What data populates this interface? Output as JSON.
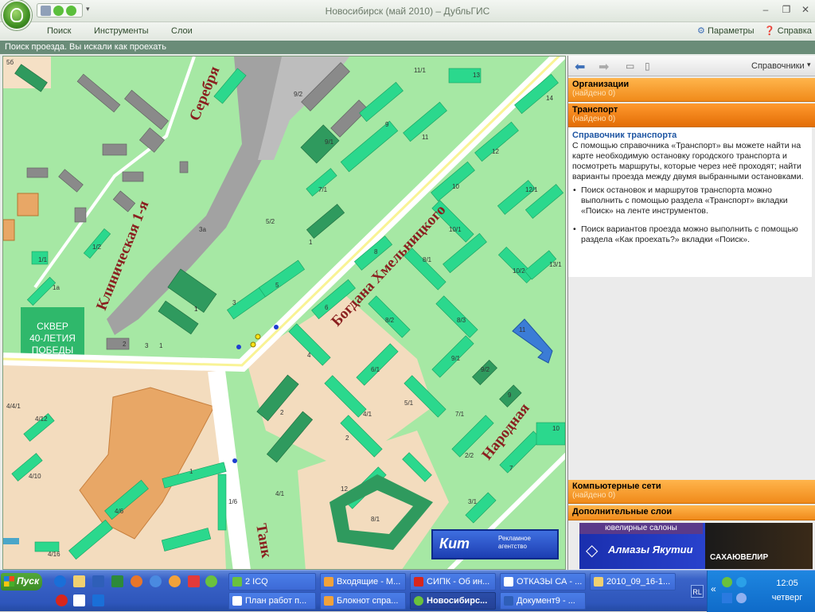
{
  "window": {
    "title": "Новосибирск (май 2010) – ДубльГИС",
    "controls": [
      "‒",
      "❐",
      "✕"
    ]
  },
  "menu": {
    "items": [
      "Поиск",
      "Инструменты",
      "Слои"
    ],
    "right": [
      "Параметры",
      "Справка"
    ]
  },
  "status_strip": "Поиск проезда. Вы искали как проехать",
  "map": {
    "streets": {
      "khmelnitsky": "Богдана Хмельницкого",
      "klinicheskaya": "Клиническая 1-я",
      "serebr": "Серебря",
      "narodnaya": "Народная",
      "tank": "Танк"
    },
    "square_label": [
      "СКВЕР",
      "40-ЛЕТИЯ",
      "ПОБЕДЫ"
    ],
    "house_numbers": [
      "9/2",
      "11/1",
      "13",
      "14",
      "9",
      "9/1",
      "11",
      "12",
      "7/1",
      "10",
      "12/1",
      "5/2",
      "3а",
      "1",
      "10/1",
      "1",
      "8",
      "8/1",
      "10/2",
      "13/1",
      "5",
      "3",
      "1",
      "6",
      "8/2",
      "8/3",
      "11",
      "6/1",
      "9/1",
      "9/2",
      "4",
      "2",
      "5/1",
      "4/1",
      "7/1",
      "9",
      "1",
      "2",
      "2/2",
      "7",
      "10",
      "12",
      "3/1",
      "8/1",
      "3",
      "1",
      "1/1",
      "1/2",
      "1а",
      "2",
      "4/12",
      "4/10",
      "4/16",
      "1/6",
      "4/6",
      "4/4/1",
      "5б",
      "4/1"
    ],
    "ad_text": "Рекламное агентство",
    "ad_brand": "Кит"
  },
  "panel": {
    "catalogs_label": "Справочники",
    "sections": [
      {
        "title": "Организации",
        "sub": "(найдено 0)"
      },
      {
        "title": "Транспорт",
        "sub": "(найдено 0)"
      }
    ],
    "info": {
      "heading": "Справочник транспорта",
      "text": "С помощью справочника «Транспорт» вы можете найти на карте необходимую остановку городского транспорта и посмотреть маршруты, которые через неё проходят; найти варианты проезда между двумя выбранными остановками.",
      "bullets": [
        "Поиск остановок и маршрутов транспорта можно выполнить с помощью раздела «Транспорт» вкладки «Поиск» на ленте инструментов.",
        "Поиск вариантов проезда можно выполнить с помощью раздела «Как проехать?» вкладки «Поиск»."
      ]
    },
    "bottom_sections": [
      {
        "title": "Компьютерные сети",
        "sub": "(найдено 0)"
      },
      {
        "title": "Дополнительные слои",
        "sub": ""
      }
    ],
    "ad": {
      "line1": "ювелирные салоны",
      "line2": "Алмазы Якутии",
      "brand": "САХАЮВЕЛИР"
    }
  },
  "taskbar": {
    "start": "Пуск",
    "row1": [
      {
        "label": "2 ICQ",
        "color": "#6ac13d"
      },
      {
        "label": "Входящие - М...",
        "color": "#f2a23a"
      },
      {
        "label": "СИПК - Об ин...",
        "color": "#d8261c"
      },
      {
        "label": "ОТКАЗЫ СА - ...",
        "color": "#ffffff"
      },
      {
        "label": "2010_09_16-1...",
        "color": "#f1d070"
      }
    ],
    "row2": [
      {
        "label": "План работ п...",
        "color": "#ffffff"
      },
      {
        "label": "Блокнот спра...",
        "color": "#f2a23a"
      },
      {
        "label": "Новосибирс...",
        "color": "#6ac13d",
        "active": true
      },
      {
        "label": "Документ9 - ...",
        "color": "#2f5fb8"
      }
    ],
    "lang": "RL",
    "time": "12:05",
    "day": "четверг"
  }
}
